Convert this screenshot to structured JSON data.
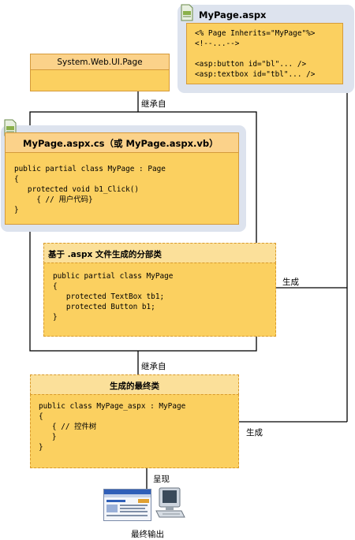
{
  "aspx_box": {
    "title": "MyPage.aspx",
    "code": [
      "<% Page Inherits=\"MyPage\"%>",
      "<!--...-->",
      "",
      "<asp:button id=\"bl\"... />",
      "<asp:textbox id=\"tbl\"... />"
    ]
  },
  "system_page": {
    "title": "System.Web.UI.Page"
  },
  "codebehind_box": {
    "title": "MyPage.aspx.cs（或 MyPage.aspx.vb）",
    "code": [
      "public partial class MyPage : Page",
      "{",
      "   protected void b1_Click()",
      "     { // 用户代码}",
      "}"
    ]
  },
  "partial_box": {
    "title": "基于 .aspx 文件生成的分部类",
    "code": [
      "public partial class MyPage",
      "{",
      "   protected TextBox tb1;",
      "   protected Button b1;",
      "}"
    ]
  },
  "final_box": {
    "title": "生成的最终类",
    "code": [
      "public class MyPage_aspx : MyPage",
      "{",
      "   { // 控件树",
      "   }",
      "}"
    ]
  },
  "labels": {
    "inherits_top": "继承自",
    "inherits_bottom": "继承自",
    "generate_partial": "生成",
    "generate_final": "生成",
    "render": "呈现",
    "final_output": "最终输出"
  },
  "icons": [
    "document-icon",
    "document-icon",
    "browser-window-icon",
    "computer-icon"
  ],
  "colors": {
    "box_fill": "#fbd060",
    "header_fill": "#fbd28a",
    "border": "#d59a3a",
    "halo": "#dde3ee"
  }
}
